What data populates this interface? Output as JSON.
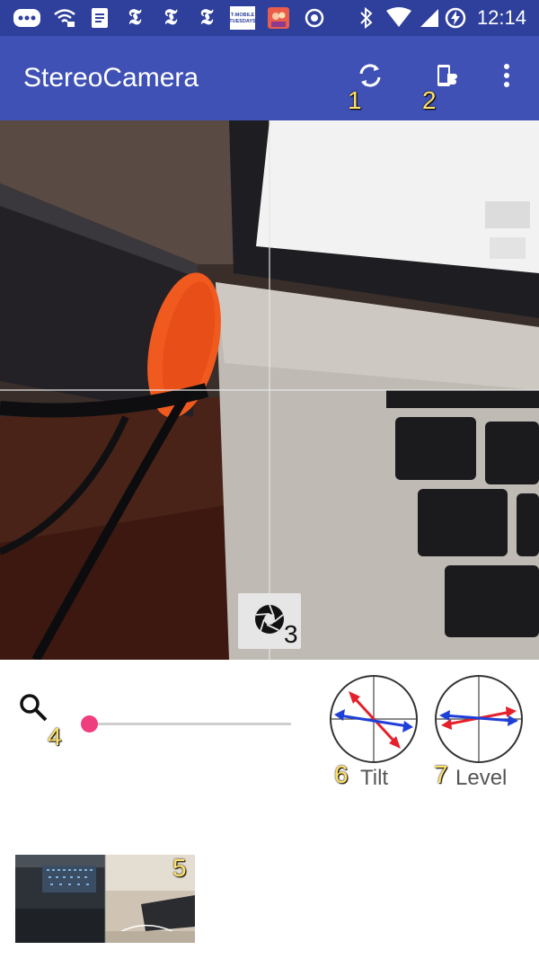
{
  "status_bar": {
    "time": "12:14",
    "icons": [
      "more-icon",
      "wifi-icon",
      "docs-icon",
      "nyt-icon",
      "nyt-icon",
      "nyt-icon",
      "tmobile-tuesdays-icon",
      "app-icon",
      "record-icon",
      "bluetooth-icon",
      "signal-icon",
      "signal-icon",
      "battery-charging-icon"
    ],
    "tmobile_text": "T-MOBILE TUESDAYS"
  },
  "app_bar": {
    "title": "StereoCamera",
    "actions": [
      "switch-camera-icon",
      "phone-orientation-icon",
      "overflow-menu-icon"
    ]
  },
  "callouts": {
    "c1": "1",
    "c2": "2",
    "c3": "3",
    "c4": "4",
    "c5": "5",
    "c6": "6",
    "c7": "7"
  },
  "controls": {
    "zoom_value": 0,
    "tilt_label": "Tilt",
    "level_label": "Level"
  },
  "colors": {
    "primary": "#3f51b5",
    "primary_dark": "#2e3f9c",
    "accent": "#ef3e7d",
    "arrow_red": "#e5202a",
    "arrow_blue": "#1f3fd9"
  }
}
